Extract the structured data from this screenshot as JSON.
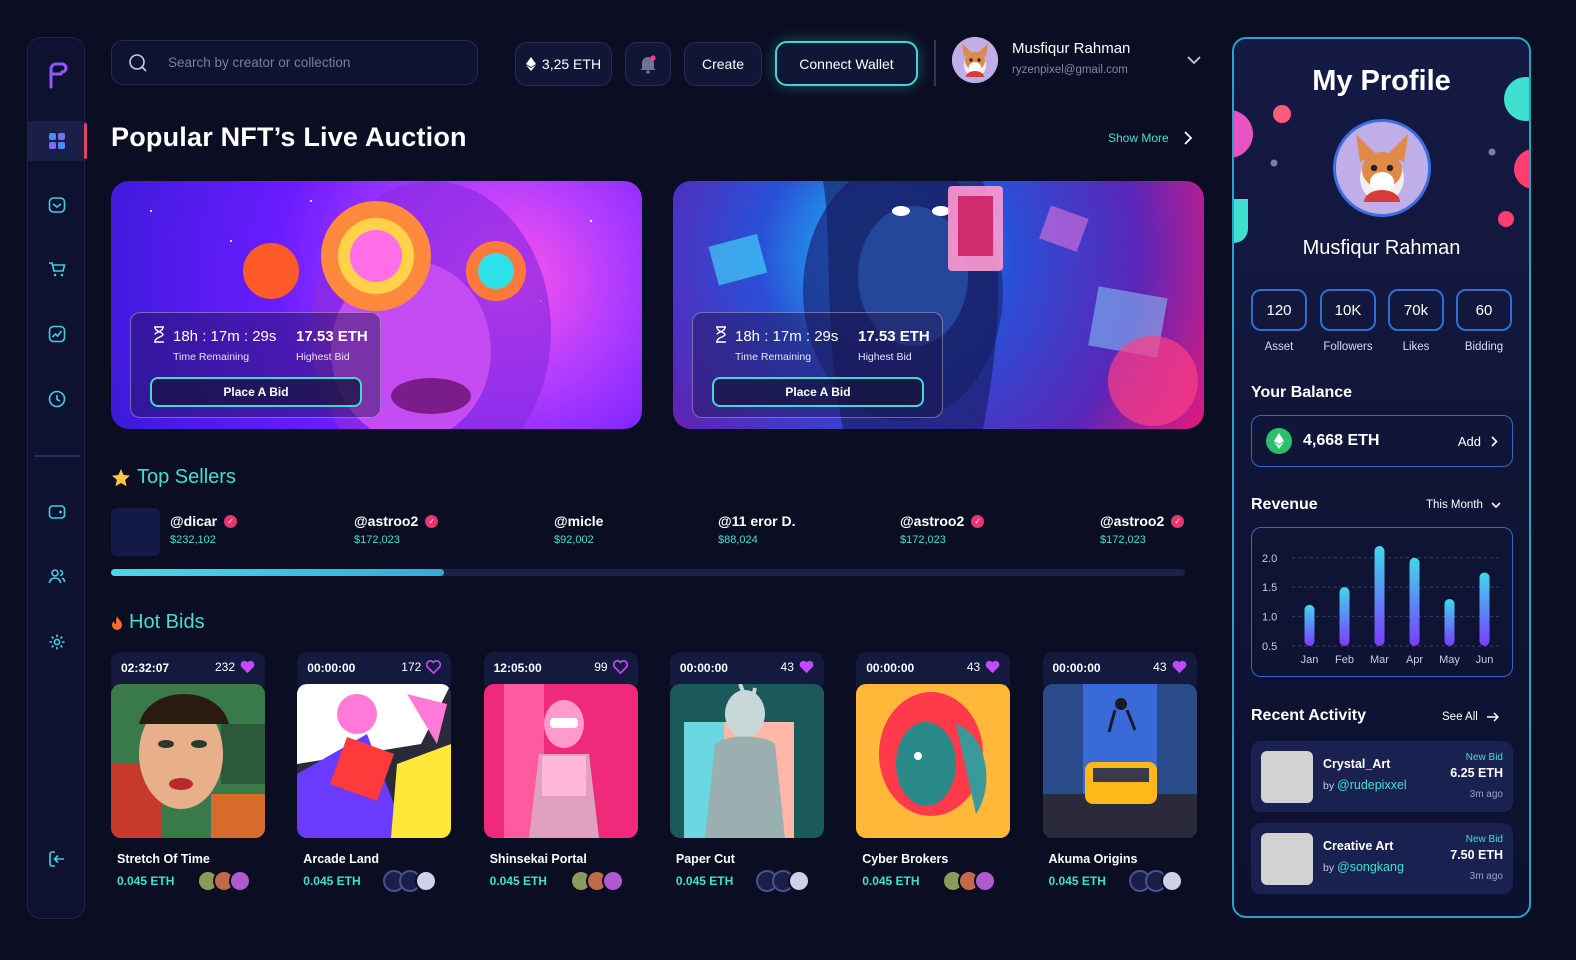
{
  "search": {
    "placeholder": "Search by creator or collection"
  },
  "topbar": {
    "balance": "3,25 ETH",
    "create_label": "Create",
    "connect_label": "Connect Wallet",
    "user_name": "Musfiqur Rahman",
    "user_email": "ryzenpixel@gmail.com"
  },
  "auction": {
    "title": "Popular NFT’s Live Auction",
    "show_more": "Show More",
    "cards": [
      {
        "time": "18h : 17m : 29s",
        "time_label": "Time Remaining",
        "bid": "17.53 ETH",
        "bid_label": "Highest Bid",
        "button": "Place A Bid"
      },
      {
        "time": "18h : 17m : 29s",
        "time_label": "Time Remaining",
        "bid": "17.53 ETH",
        "bid_label": "Highest Bid",
        "button": "Place A Bid"
      }
    ]
  },
  "top_sellers": {
    "title": "Top Sellers",
    "progress": 0.31,
    "items": [
      {
        "handle": "@dicar",
        "amount": "$232,102",
        "verified": true
      },
      {
        "handle": "@astroo2",
        "amount": "$172,023",
        "verified": true
      },
      {
        "handle": "@micle",
        "amount": "$92,002",
        "verified": false
      },
      {
        "handle": "@11 eror D.",
        "amount": "$88,024",
        "verified": false
      },
      {
        "handle": "@astroo2",
        "amount": "$172,023",
        "verified": true
      },
      {
        "handle": "@astroo2",
        "amount": "$172,023",
        "verified": true
      }
    ]
  },
  "hot_bids": {
    "title": "Hot Bids",
    "items": [
      {
        "time": "02:32:07",
        "likes": "232",
        "liked": true,
        "name": "Stretch Of Time",
        "price": "0.045 ETH"
      },
      {
        "time": "00:00:00",
        "likes": "172",
        "liked": false,
        "name": "Arcade Land",
        "price": "0.045 ETH"
      },
      {
        "time": "12:05:00",
        "likes": "99",
        "liked": false,
        "name": "Shinsekai Portal",
        "price": "0.045 ETH"
      },
      {
        "time": "00:00:00",
        "likes": "43",
        "liked": true,
        "name": "Paper Cut",
        "price": "0.045 ETH"
      },
      {
        "time": "00:00:00",
        "likes": "43",
        "liked": true,
        "name": "Cyber Brokers",
        "price": "0.045 ETH"
      },
      {
        "time": "00:00:00",
        "likes": "43",
        "liked": true,
        "name": "Akuma Origins",
        "price": "0.045 ETH"
      }
    ]
  },
  "profile": {
    "title": "My Profile",
    "name": "Musfiqur Rahman",
    "stats": [
      {
        "value": "120",
        "label": "Asset"
      },
      {
        "value": "10K",
        "label": "Followers"
      },
      {
        "value": "70k",
        "label": "Likes"
      },
      {
        "value": "60",
        "label": "Bidding"
      }
    ],
    "balance_title": "Your Balance",
    "balance": "4,668 ETH",
    "add_label": "Add",
    "revenue_title": "Revenue",
    "period": "This Month",
    "activity_title": "Recent Activity",
    "see_all": "See All",
    "activity": [
      {
        "name": "Crystal_Art",
        "by": "by",
        "user": "@rudepixxel",
        "type": "New Bid",
        "amount": "6.25 ETH",
        "ago": "3m ago"
      },
      {
        "name": "Creative Art",
        "by": "by",
        "user": "@songkang",
        "type": "New Bid",
        "amount": "7.50 ETH",
        "ago": "3m ago"
      }
    ]
  },
  "chart_data": {
    "type": "bar",
    "categories": [
      "Jan",
      "Feb",
      "Mar",
      "Apr",
      "May",
      "Jun"
    ],
    "values": [
      1.2,
      1.5,
      2.2,
      2.0,
      1.3,
      1.75
    ],
    "y_ticks": [
      "2.0",
      "1.5",
      "1.0",
      "0.5"
    ],
    "ylim": [
      0.5,
      2.2
    ],
    "grid": true
  },
  "colors": {
    "accent": "#3fe0cf",
    "brand": "#e0406a",
    "panel_border": "#21a6c9"
  }
}
